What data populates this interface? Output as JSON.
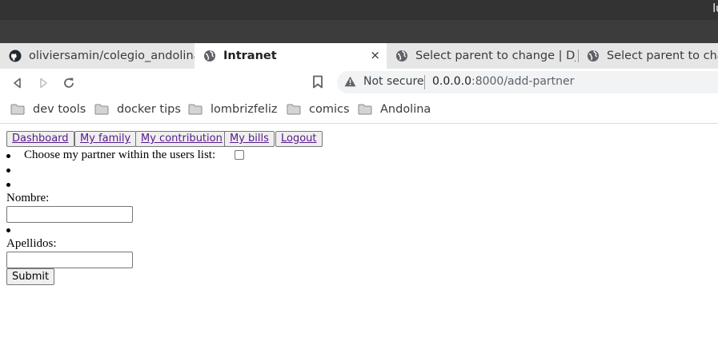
{
  "os": {
    "clock_fragment": "lu"
  },
  "tabs": [
    {
      "title": "oliviersamin/colegio_andolina",
      "icon": "github-icon"
    },
    {
      "title": "Intranet",
      "icon": "globe-icon",
      "active": true,
      "close": "×"
    },
    {
      "title": "Select parent to change | Django",
      "icon": "globe-icon"
    },
    {
      "title": "Select parent to change",
      "icon": "globe-icon"
    }
  ],
  "toolbar": {
    "security_label": "Not secure",
    "url_host": "0.0.0.0",
    "url_path": ":8000/add-partner"
  },
  "bookmarks": [
    {
      "label": "dev tools"
    },
    {
      "label": "docker tips"
    },
    {
      "label": "lombrizfeliz"
    },
    {
      "label": "comics"
    },
    {
      "label": "Andolina"
    }
  ],
  "page": {
    "nav": [
      {
        "label": "Dashboard"
      },
      {
        "label": "My family"
      },
      {
        "label": "My contribution"
      },
      {
        "label": "My bills"
      },
      {
        "label": "Logout"
      }
    ],
    "choose_partner_label": "Choose my partner within the users list:",
    "nombre_label": "Nombre:",
    "nombre_value": "",
    "apellidos_label": "Apellidos:",
    "apellidos_value": "",
    "submit_label": "Submit"
  },
  "colors": {
    "link": "#551a8b",
    "os_bar": "#333333",
    "tab_strip": "#e6e6e6"
  }
}
